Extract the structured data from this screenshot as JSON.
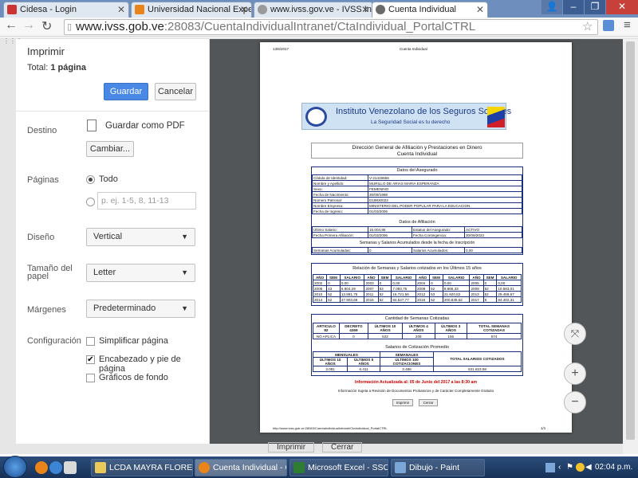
{
  "browser": {
    "tabs": [
      {
        "title": "Cidesa - Login",
        "color": "#c33",
        "active": false
      },
      {
        "title": "Universidad Nacional Experim",
        "color": "#e8841a",
        "active": false
      },
      {
        "title": "www.ivss.gov.ve - IVSS Inst",
        "color": "#9a9a9a",
        "active": false
      },
      {
        "title": "Cuenta Individual",
        "color": "#6a6a6a",
        "active": true
      }
    ],
    "url_host": "www.ivss.gob.ve",
    "url_path": ":28083/CuentaIndividualIntranet/CtaIndividual_PortalCTRL"
  },
  "print": {
    "title": "Imprimir",
    "total_label": "Total:",
    "total_value": "1 página",
    "save_label": "Guardar",
    "cancel_label": "Cancelar",
    "destination_label": "Destino",
    "destination_value": "Guardar como PDF",
    "change_label": "Cambiar...",
    "pages_label": "Páginas",
    "pages_all": "Todo",
    "pages_placeholder": "p. ej. 1-5, 8, 11-13",
    "layout_label": "Diseño",
    "layout_value": "Vertical",
    "paper_label_1": "Tamaño del",
    "paper_label_2": "papel",
    "paper_value": "Letter",
    "margins_label": "Márgenes",
    "margins_value": "Predeterminado",
    "settings_label": "Configuración",
    "opt_simplify": "Simplificar página",
    "opt_headers": "Encabezado y pie de página",
    "opt_background": "Gráficos de fondo"
  },
  "doc": {
    "date": "13/6/2017",
    "page_title": "Cuenta Individual",
    "banner_title": "Instituto Venezolano de los Seguros Sociales",
    "banner_subtitle": "La Seguridad Social es tu derecho",
    "direction_line1": "Dirección General de Afiliación y Prestaciones en Dinero",
    "direction_line2": "Cuenta Individual",
    "insured_header": "Datos del Asegurado",
    "insured_rows": [
      [
        "Cédula de Identidad:",
        "V-21419656"
      ],
      [
        "Nombre y Apellido:",
        "MURILLO DE ARIAS MARIA ESPERANZA"
      ],
      [
        "Sexo:",
        "FEMENINO"
      ],
      [
        "Fecha de Nacimiento:",
        "30/09/1968"
      ],
      [
        "Número Patronal:",
        "D19830022"
      ],
      [
        "Nombre Empresa:",
        "MINISTERIO DEL PODER POPULAR PARA LA EDUCACION"
      ],
      [
        "Fecha de Ingreso:",
        "01/03/2006"
      ]
    ],
    "affil_header": "Datos de Afiliación",
    "affil_rows": [
      [
        "Último Salario:",
        "15.004,86",
        "Estatus del Asegurado:",
        "ACTIVO"
      ],
      [
        "Fecha Primera Afiliación:",
        "01/03/2006",
        "Fecha Contingencia:",
        "30/09/2023"
      ]
    ],
    "weeks_header": "Semanas y Salarios Acumulados desde la fecha de Inscripción",
    "weeks_row": [
      "Semanas Acumuladas:",
      "0",
      "Salarios Acumulados:",
      "0,00"
    ],
    "relation_header": "Relación de Semanas y Salarios cotizados en los Últimos 15 años",
    "relation_cols": [
      "AÑO",
      "SEM",
      "SALARIO"
    ],
    "relation_rows": [
      [
        "2002",
        "0",
        "0,00",
        "2003",
        "0",
        "0,00",
        "2004",
        "0",
        "0,00",
        "2005",
        "0",
        "0,00"
      ],
      [
        "2006",
        "43",
        "6.804,29",
        "2007",
        "53",
        "7.093,75",
        "2008",
        "52",
        "8.865,33",
        "2009",
        "52",
        "10.583,01"
      ],
      [
        "2010",
        "52",
        "13.881,76",
        "2011",
        "52",
        "16.721,56",
        "2012",
        "53",
        "21.920,82",
        "2013",
        "52",
        "29.458,67"
      ],
      [
        "2014",
        "52",
        "47.903,69",
        "2015",
        "52",
        "84.547,77",
        "2016",
        "52",
        "200.839,62",
        "2017",
        "9",
        "84.402,31"
      ]
    ],
    "quoted_header": "Cantidad de Semanas Cotizadas",
    "quoted_cols": [
      "ARTICULO 82",
      "DECRETO 4269",
      "ÚLTIMOS 10 AÑOS",
      "ÚLTIMOS 4 AÑOS",
      "ÚLTIMOS 3 AÑOS",
      "TOTAL SEMANAS COTIZADAS"
    ],
    "quoted_vals": [
      "NO APLICA",
      "0",
      "522",
      "208",
      "156",
      "574"
    ],
    "avg_header": "Salarios de Cotización Promedio",
    "avg_group1": "MENSUALES",
    "avg_group2": "SEMANALES",
    "avg_total_label": "TOTAL SALARIOS COTIZADOS",
    "avg_cols": [
      "ÚLTIMOS 10 AÑOS",
      "ÚLTIMOS 5 AÑOS",
      "ÚLTIMOS 100 COTIZACIONES"
    ],
    "avg_vals": [
      "3.081",
      "6.411",
      "3.486"
    ],
    "avg_total": "531.823,58",
    "updated_line": "Información Actualizada al: 05 de Junio del 2017 a las 8:30 am",
    "disclaimer": "Información Sujeta a Revisión de Documentos Probatorios y de Carácter Completamente Gratuito",
    "print_btn": "Imprimir",
    "close_btn": "Cerrar",
    "footer_url": "http://www.ivss.gob.ve:28083/CuentaIndividualIntranet/CtaIndividual_PortalCTRL",
    "footer_page": "1/1"
  },
  "behind": {
    "btn1": "Imprimir",
    "btn2": "Cerrar"
  },
  "taskbar": {
    "items": [
      {
        "label": "LCDA MAYRA FLORES",
        "color": "#e8c95a",
        "active": false
      },
      {
        "label": "Cuenta Individual - Go...",
        "color": "#e8841a",
        "active": true
      },
      {
        "label": "Microsoft Excel - SSO",
        "color": "#2e7d32",
        "active": false
      },
      {
        "label": "Dibujo - Paint",
        "color": "#7aa7d8",
        "active": false
      }
    ],
    "clock": "02:04 p.m."
  }
}
